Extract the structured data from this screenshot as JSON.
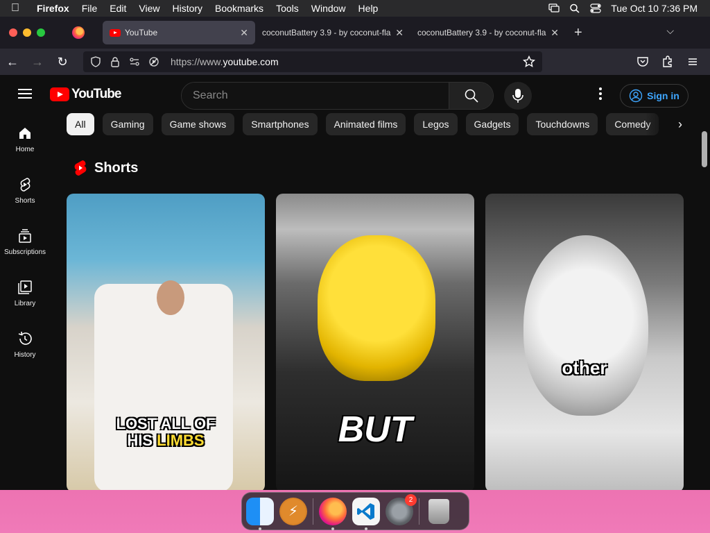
{
  "menubar": {
    "app_name": "Firefox",
    "menus": [
      "File",
      "Edit",
      "View",
      "History",
      "Bookmarks",
      "Tools",
      "Window",
      "Help"
    ],
    "clock": "Tue Oct 10  7:36 PM"
  },
  "browser": {
    "tabs": [
      {
        "title": "YouTube",
        "active": true
      },
      {
        "title": "coconutBattery 3.9 - by coconut-fla",
        "active": false
      },
      {
        "title": "coconutBattery 3.9 - by coconut-fla",
        "active": false
      }
    ],
    "url_prefix": "https://www.",
    "url_domain": "youtube.com"
  },
  "youtube": {
    "logo_text": "YouTube",
    "search_placeholder": "Search",
    "signin_label": "Sign in",
    "guide": [
      {
        "label": "Home",
        "icon": "home-icon"
      },
      {
        "label": "Shorts",
        "icon": "shorts-icon"
      },
      {
        "label": "Subscriptions",
        "icon": "subscriptions-icon"
      },
      {
        "label": "Library",
        "icon": "library-icon"
      },
      {
        "label": "History",
        "icon": "history-icon"
      }
    ],
    "chips": [
      "All",
      "Gaming",
      "Game shows",
      "Smartphones",
      "Animated films",
      "Legos",
      "Gadgets",
      "Touchdowns",
      "Comedy"
    ],
    "shorts_title": "Shorts",
    "shorts": [
      {
        "overlay_line1": "LOST ALL OF",
        "overlay_line2a": "HIS ",
        "overlay_line2b": "LIMBS"
      },
      {
        "overlay": "BUT"
      },
      {
        "overlay": "other"
      }
    ]
  },
  "dock": {
    "settings_badge": "2"
  },
  "colors": {
    "yt_red": "#ff0000",
    "signin_blue": "#3ea6ff",
    "chip_active_bg": "#f1f1f1",
    "chip_bg": "#272727"
  }
}
